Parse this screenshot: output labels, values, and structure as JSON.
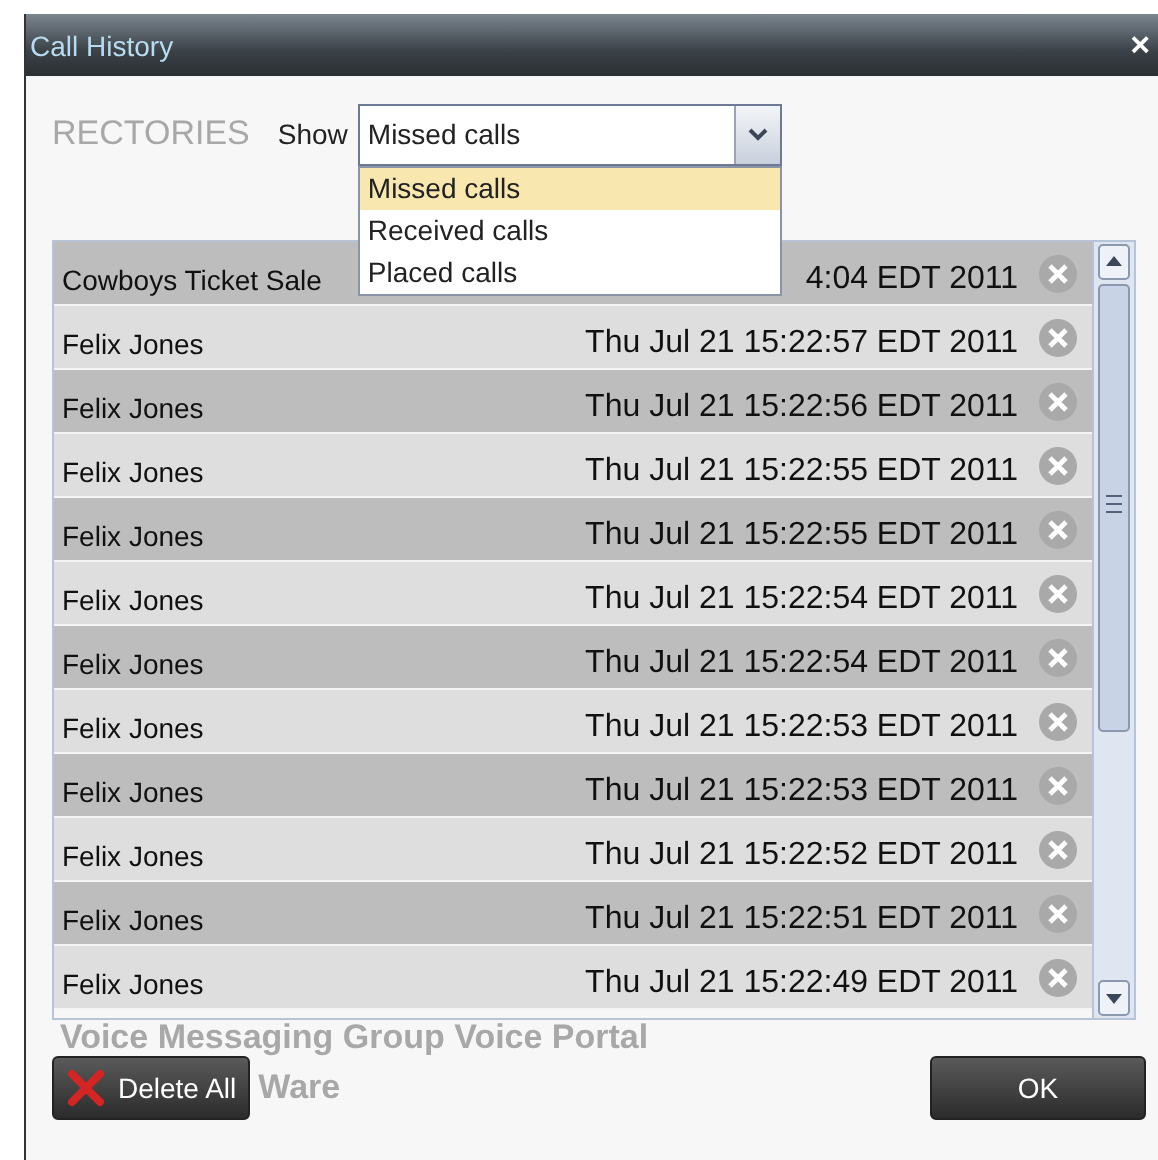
{
  "window": {
    "title": "Call History",
    "close": "×"
  },
  "background_texts": [
    "RECTORIES",
    "Voice Messaging Group Voice Portal",
    "Ware"
  ],
  "filter": {
    "label": "Show",
    "value": "Missed calls",
    "expanded": true,
    "options": [
      {
        "label": "Missed calls",
        "selected": true
      },
      {
        "label": "Received calls",
        "selected": false
      },
      {
        "label": "Placed calls",
        "selected": false
      }
    ]
  },
  "calls": [
    {
      "name": "Cowboys Ticket Sale",
      "time": "4:04 EDT 2011"
    },
    {
      "name": "Felix Jones",
      "time": "Thu Jul 21 15:22:57 EDT 2011"
    },
    {
      "name": "Felix Jones",
      "time": "Thu Jul 21 15:22:56 EDT 2011"
    },
    {
      "name": "Felix Jones",
      "time": "Thu Jul 21 15:22:55 EDT 2011"
    },
    {
      "name": "Felix Jones",
      "time": "Thu Jul 21 15:22:55 EDT 2011"
    },
    {
      "name": "Felix Jones",
      "time": "Thu Jul 21 15:22:54 EDT 2011"
    },
    {
      "name": "Felix Jones",
      "time": "Thu Jul 21 15:22:54 EDT 2011"
    },
    {
      "name": "Felix Jones",
      "time": "Thu Jul 21 15:22:53 EDT 2011"
    },
    {
      "name": "Felix Jones",
      "time": "Thu Jul 21 15:22:53 EDT 2011"
    },
    {
      "name": "Felix Jones",
      "time": "Thu Jul 21 15:22:52 EDT 2011"
    },
    {
      "name": "Felix Jones",
      "time": "Thu Jul 21 15:22:51 EDT 2011"
    },
    {
      "name": "Felix Jones",
      "time": "Thu Jul 21 15:22:49 EDT 2011"
    }
  ],
  "buttons": [
    {
      "kind": "delete",
      "label": "Delete All"
    },
    {
      "kind": "ok",
      "label": "OK"
    }
  ]
}
